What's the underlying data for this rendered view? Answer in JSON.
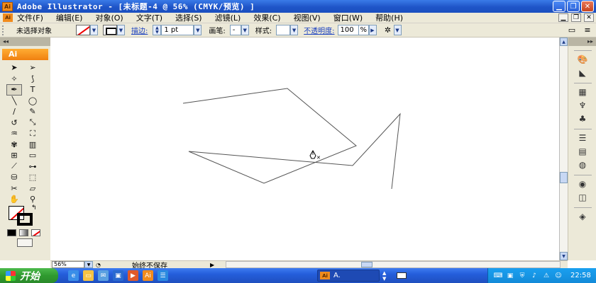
{
  "window": {
    "app_logo": "Ai",
    "title": "Adobe Illustrator - [未标题-4 @ 56% (CMYK/预览) ]",
    "buttons": [
      "minimize-icon",
      "restore-icon",
      "close-icon"
    ]
  },
  "menu": {
    "items": [
      "文件(F)",
      "编辑(E)",
      "对象(O)",
      "文字(T)",
      "选择(S)",
      "滤镜(L)",
      "效果(C)",
      "视图(V)",
      "窗口(W)",
      "帮助(H)"
    ]
  },
  "control_bar": {
    "selection_label": "未选择对象",
    "stroke_label": "描边:",
    "stroke_weight": "1 pt",
    "brush_label": "画笔:",
    "brush_value": "-",
    "style_label": "样式:",
    "opacity_label": "不透明度:",
    "opacity_value": "100",
    "opacity_unit": "%"
  },
  "tools": {
    "panel_label": "Ai",
    "items": [
      "selection-tool-icon",
      "direct-selection-tool-icon",
      "magic-wand-tool-icon",
      "lasso-tool-icon",
      "pen-tool-icon",
      "type-tool-icon",
      "line-segment-tool-icon",
      "ellipse-tool-icon",
      "paintbrush-tool-icon",
      "pencil-tool-icon",
      "rotate-tool-icon",
      "scale-tool-icon",
      "warp-tool-icon",
      "free-transform-tool-icon",
      "symbol-sprayer-tool-icon",
      "column-graph-tool-icon",
      "mesh-tool-icon",
      "gradient-tool-icon",
      "eyedropper-tool-icon",
      "blend-tool-icon",
      "live-paint-bucket-tool-icon",
      "live-paint-selection-tool-icon",
      "slice-tool-icon",
      "eraser-tool-icon",
      "hand-tool-icon",
      "zoom-tool-icon"
    ],
    "selected": "pen-tool-icon"
  },
  "status": {
    "zoom": "56%",
    "message": "始终不保存"
  },
  "taskbar": {
    "start_label": "开始",
    "task_label": "A.",
    "clock": "22:58"
  },
  "colors": {
    "title_bar": "#245edb",
    "taskbar": "#245edb",
    "start_button": "#2f9a2f",
    "ai_orange": "#f08010",
    "chrome": "#ece9d8"
  }
}
